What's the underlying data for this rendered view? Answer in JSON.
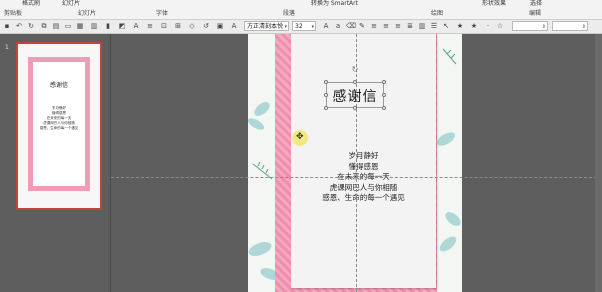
{
  "ribbon": {
    "top_items": [
      "格式刷",
      "幻灯片",
      "转换为 SmartArt",
      "形状效果",
      "选择"
    ],
    "groups": [
      "剪贴板",
      "幻灯片",
      "字体",
      "段落",
      "绘图",
      "编辑"
    ]
  },
  "toolbar": {
    "font_name": "方正清刻本悦",
    "font_size": "32"
  },
  "thumbnail": {
    "number": "1",
    "title": "感谢信",
    "lines": [
      "岁月静好",
      "懂得感恩",
      "在未来的每一天",
      "虎课网巴人与你相随",
      "感恩，生命的每一个遇见"
    ]
  },
  "slide": {
    "title": "感谢信",
    "lines": [
      "岁月静好",
      "懂得感恩",
      "在未来的每一天",
      "虎课网巴人与你相随",
      "感恩、生命的每一个遇见"
    ]
  }
}
